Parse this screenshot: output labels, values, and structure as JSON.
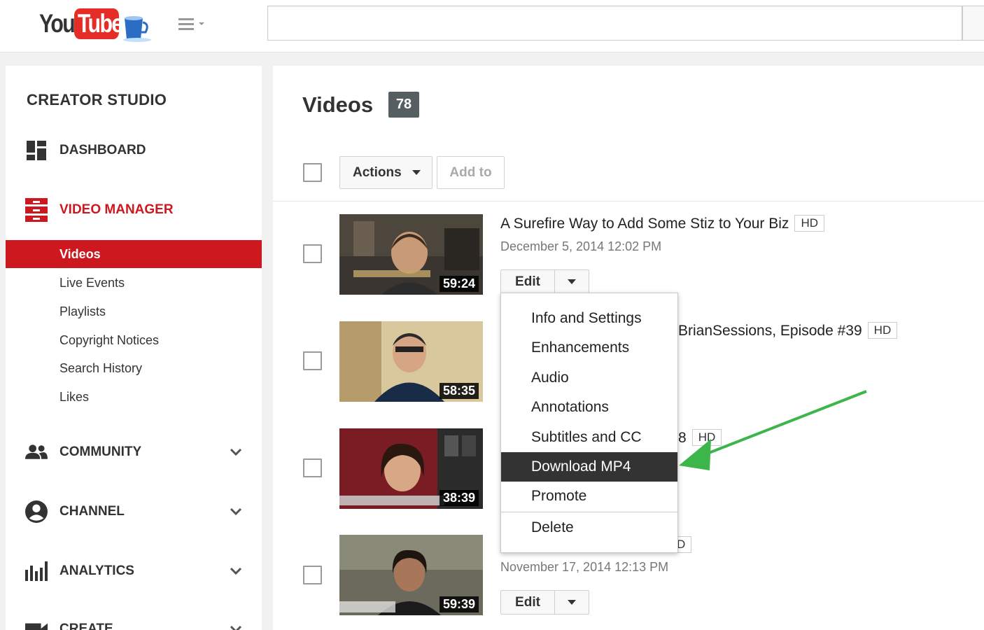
{
  "header": {
    "logo_you": "You",
    "logo_tube": "Tube",
    "search_placeholder": ""
  },
  "sidebar": {
    "title": "CREATOR STUDIO",
    "dashboard": "DASHBOARD",
    "video_manager": "VIDEO MANAGER",
    "sub_items": [
      "Videos",
      "Live Events",
      "Playlists",
      "Copyright Notices",
      "Search History",
      "Likes"
    ],
    "community": "COMMUNITY",
    "channel": "CHANNEL",
    "analytics": "ANALYTICS",
    "create": "CREATE"
  },
  "main": {
    "title": "Videos",
    "count": "78",
    "actions_label": "Actions",
    "add_to_label": "Add to",
    "edit_label": "Edit",
    "hd_label": "HD",
    "videos": [
      {
        "title": "A Surefire Way to Add Some Stiz to Your Biz",
        "date": "December 5, 2014 12:02 PM",
        "duration": "59:24"
      },
      {
        "title": "BrianSessions, Episode #39",
        "date": "",
        "duration": "58:35"
      },
      {
        "title": "8",
        "date": "",
        "duration": "38:39"
      },
      {
        "title": "",
        "date": "November 17, 2014 12:13 PM",
        "duration": "59:39"
      }
    ],
    "hd_fragment": "D"
  },
  "menu": {
    "items": [
      "Info and Settings",
      "Enhancements",
      "Audio",
      "Annotations",
      "Subtitles and CC",
      "Download MP4",
      "Promote",
      "Delete"
    ],
    "selected": "Download MP4"
  },
  "colors": {
    "brand_red": "#cc181e",
    "arrow_green": "#3cb54a",
    "menu_selected": "#333333"
  }
}
